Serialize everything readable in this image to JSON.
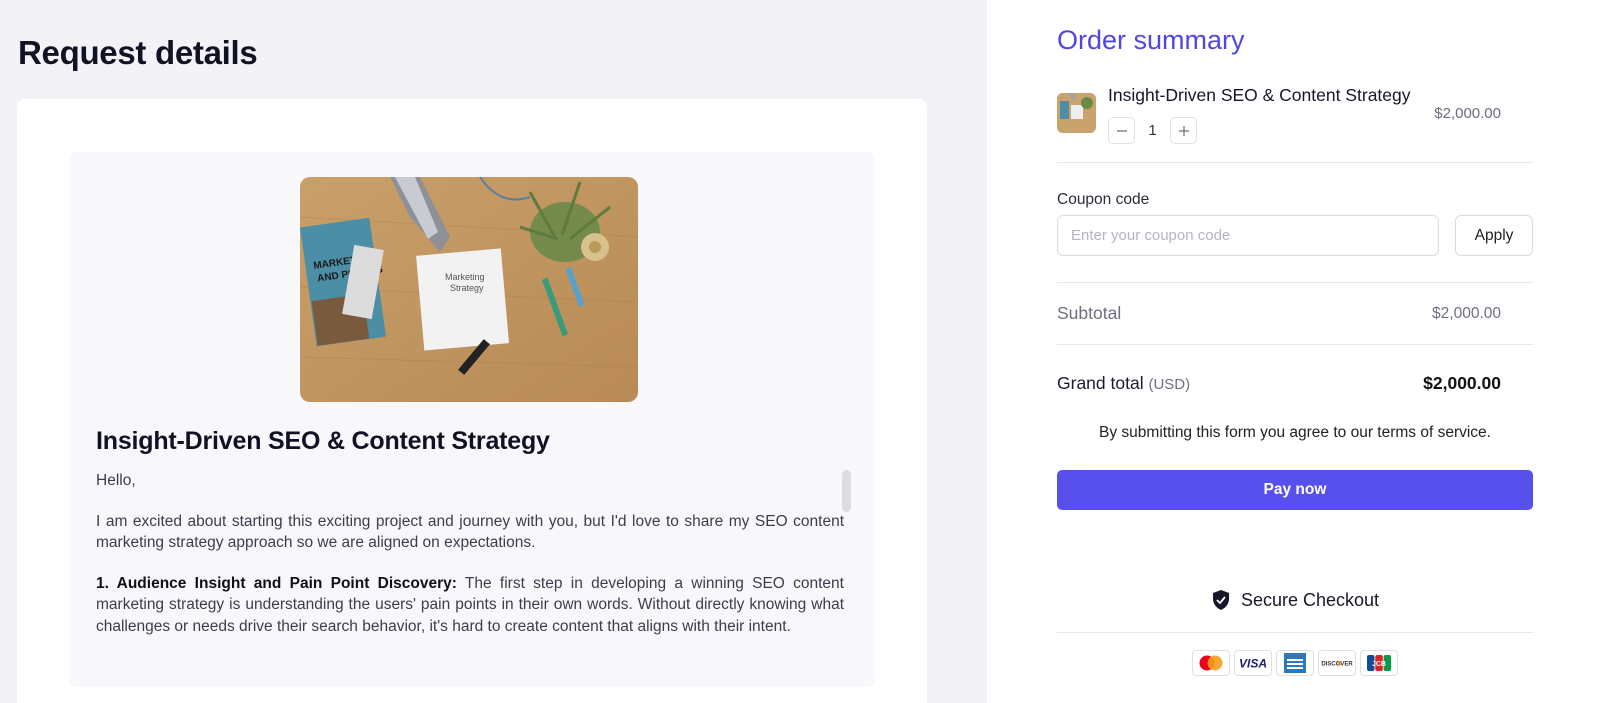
{
  "request": {
    "page_title": "Request details",
    "hero_image_text": [
      "Marketing",
      "Strategy"
    ],
    "book_text": [
      "MARKETING",
      "AND PRICING"
    ],
    "title": "Insight-Driven SEO & Content Strategy",
    "greeting": "Hello,",
    "intro": "I am excited about starting this exciting project and journey with you, but I'd love to share my SEO content marketing strategy approach so we are aligned on expectations.",
    "point1_heading": "1. Audience Insight and Pain Point Discovery:",
    "point1_body": " The first step in developing a winning SEO content marketing strategy is understanding the users' pain points in their own words. Without directly knowing what challenges or needs drive their search behavior, it's hard to create content that aligns with their intent."
  },
  "order": {
    "title": "Order summary",
    "product": {
      "name": "Insight-Driven SEO & Content Strategy",
      "quantity": "1",
      "price": "$2,000.00",
      "thumb_icon": "marketing-photo-thumbnail"
    },
    "coupon": {
      "label": "Coupon code",
      "placeholder": "Enter your coupon code",
      "value": "",
      "apply_label": "Apply"
    },
    "subtotal_label": "Subtotal",
    "subtotal_value": "$2,000.00",
    "grand_total_label": "Grand total",
    "grand_total_currency": "(USD)",
    "grand_total_value": "$2,000.00",
    "terms_text": "By submitting this form you agree to our terms of service.",
    "pay_label": "Pay now",
    "secure_label": "Secure Checkout",
    "payment_cards": [
      {
        "name": "mastercard-icon"
      },
      {
        "name": "visa-icon",
        "text": "VISA"
      },
      {
        "name": "amex-icon"
      },
      {
        "name": "discover-icon",
        "text": "DISCOVER"
      },
      {
        "name": "jcb-icon",
        "text": "JCB"
      }
    ]
  },
  "colors": {
    "accent": "#5850ec",
    "title_accent": "#4f46e5",
    "left_background": "#f3f3f7"
  }
}
